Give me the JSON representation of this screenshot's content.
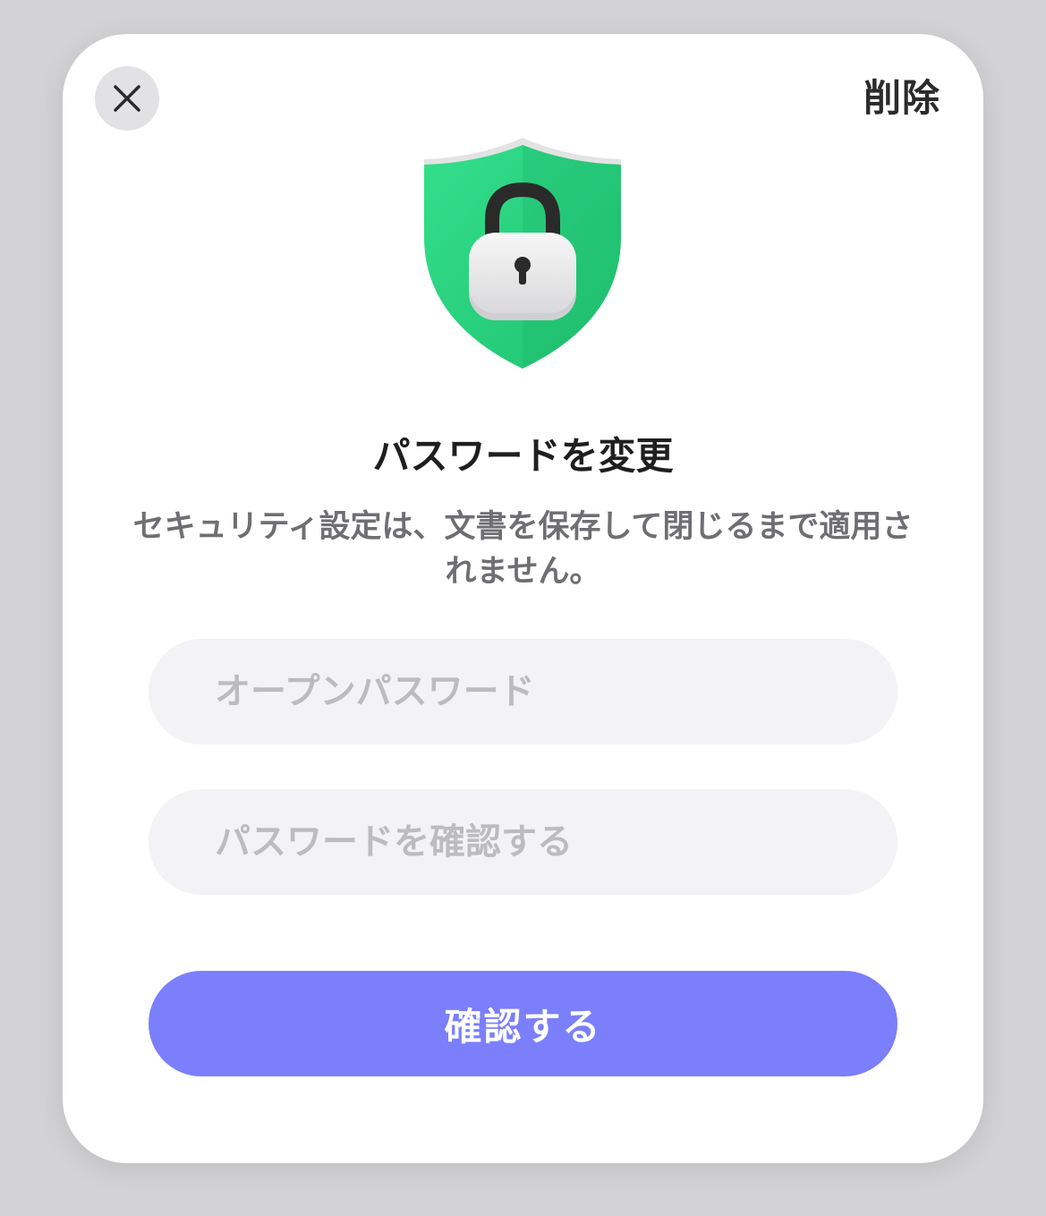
{
  "dialog": {
    "delete_label": "削除",
    "title": "パスワードを変更",
    "description": "セキュリティ設定は、文書を保存して閉じるまで適用されません。",
    "open_password_placeholder": "オープンパスワード",
    "confirm_password_placeholder": "パスワードを確認する",
    "confirm_label": "確認する"
  },
  "icons": {
    "close": "close-icon",
    "hero": "shield-lock-icon"
  },
  "colors": {
    "accent": "#7b7ffb",
    "shield": "#2bd47f",
    "field_bg": "#f3f3f5",
    "placeholder": "#bcbcc0"
  }
}
